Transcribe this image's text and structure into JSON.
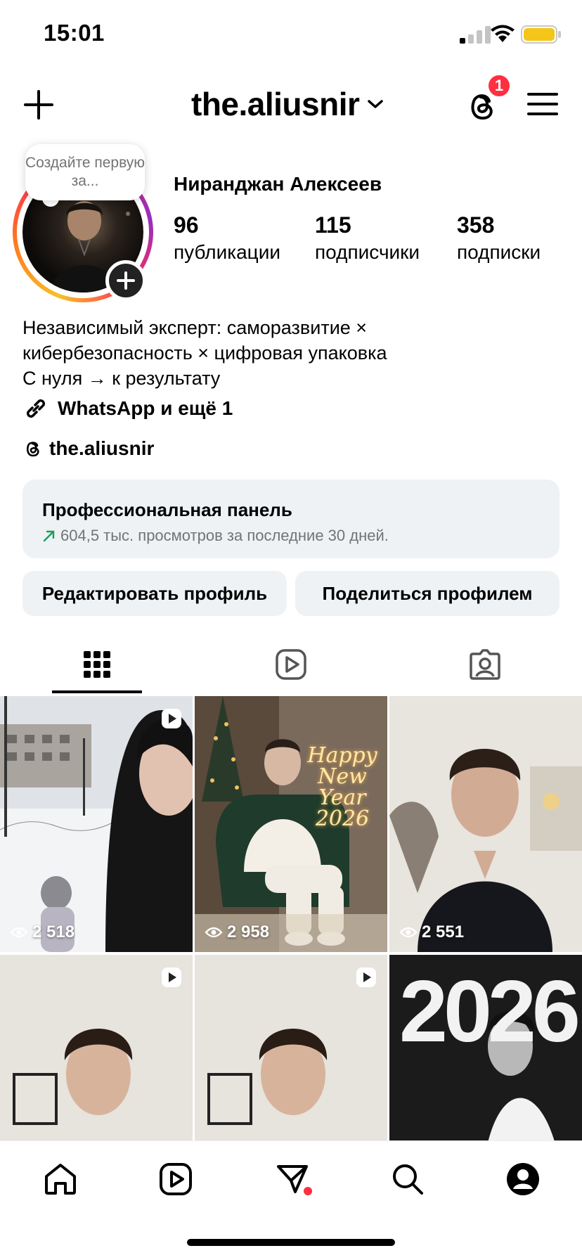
{
  "status_bar": {
    "time": "15:01"
  },
  "header": {
    "username": "the.aliusnir",
    "notification_count": "1"
  },
  "profile": {
    "tooltip": "Создайте первую за...",
    "full_name": "Ниранджан Алексеев",
    "stats": [
      {
        "value": "96",
        "label": "публикации"
      },
      {
        "value": "115",
        "label": "подписчики"
      },
      {
        "value": "358",
        "label": "подписки"
      }
    ],
    "bio_lines": [
      "Независимый эксперт: саморазвитие ×",
      "кибербезопасность × цифровая упаковка",
      "С нуля → к результату"
    ],
    "links_label": "WhatsApp и ещё 1",
    "threads_handle": "the.aliusnir"
  },
  "dashboard": {
    "title": "Профессиональная панель",
    "subtitle": "604,5 тыс. просмотров за последние 30 дней.",
    "trend_color": "#1a9e5a"
  },
  "actions": {
    "edit_label": "Редактировать профиль",
    "share_label": "Поделиться профилем"
  },
  "tabs": {
    "active": "grid",
    "items": [
      "grid-icon",
      "reels-icon",
      "tagged-icon"
    ]
  },
  "grid": {
    "posts": [
      {
        "views": "2 518",
        "is_reel": true,
        "theme": "snow selfie"
      },
      {
        "views": "2 958",
        "is_reel": false,
        "theme": "new year armchair",
        "overlay_text": "Happy New Year 2026"
      },
      {
        "views": "2 551",
        "is_reel": false,
        "theme": "portrait"
      },
      {
        "views": "",
        "is_reel": true,
        "theme": "video selfie"
      },
      {
        "views": "",
        "is_reel": true,
        "theme": "video selfie"
      },
      {
        "views": "",
        "is_reel": false,
        "theme": "2026 bw",
        "overlay_text": "2026"
      }
    ]
  },
  "bottom_nav": {
    "items": [
      "home-icon",
      "reels-icon",
      "messages-icon",
      "search-icon",
      "profile-icon"
    ]
  },
  "colors": {
    "accent_red": "#ff2f40",
    "button_bg": "#eff2f5"
  }
}
